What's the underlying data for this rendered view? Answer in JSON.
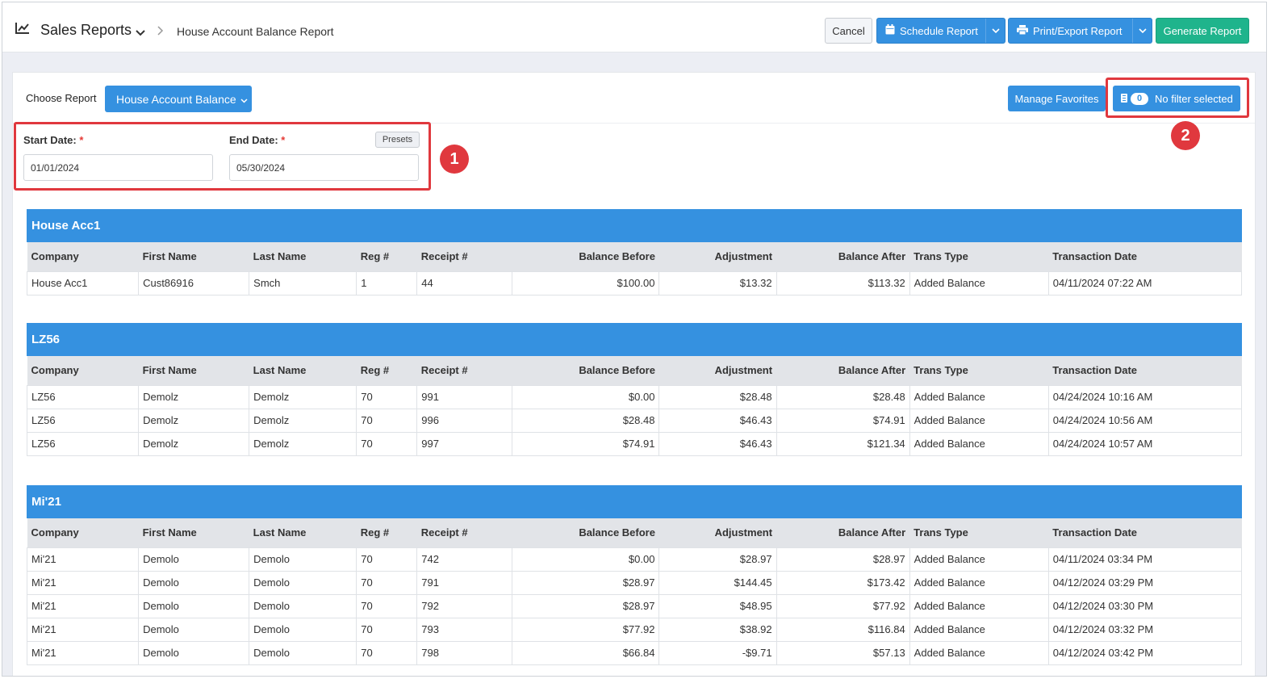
{
  "header": {
    "app_title": "Sales Reports",
    "breadcrumb": "House Account Balance Report",
    "buttons": {
      "cancel": "Cancel",
      "schedule": "Schedule Report",
      "print_export": "Print/Export Report",
      "generate": "Generate Report"
    }
  },
  "controls": {
    "choose_label": "Choose Report",
    "report_selected": "House Account Balance",
    "manage_favorites": "Manage Favorites",
    "filter_count": "0",
    "filter_label": "No filter selected",
    "start_date_label": "Start Date:",
    "end_date_label": "End Date:",
    "required_mark": "*",
    "start_date_value": "01/01/2024",
    "end_date_value": "05/30/2024",
    "presets": "Presets"
  },
  "annotations": {
    "marker1": "1",
    "marker2": "2",
    "color": "#e0383e"
  },
  "colors": {
    "primary": "#3591e0",
    "success": "#1fb48c"
  },
  "columns": [
    "Company",
    "First Name",
    "Last Name",
    "Reg #",
    "Receipt #",
    "Balance Before",
    "Adjustment",
    "Balance After",
    "Trans Type",
    "Transaction Date"
  ],
  "groups": [
    {
      "title": "House Acc1",
      "rows": [
        [
          "House Acc1",
          "Cust86916",
          "Smch",
          "1",
          "44",
          "$100.00",
          "$13.32",
          "$113.32",
          "Added Balance",
          "04/11/2024 07:22 AM"
        ]
      ]
    },
    {
      "title": "LZ56",
      "rows": [
        [
          "LZ56",
          "Demolz",
          "Demolz",
          "70",
          "991",
          "$0.00",
          "$28.48",
          "$28.48",
          "Added Balance",
          "04/24/2024 10:16 AM"
        ],
        [
          "LZ56",
          "Demolz",
          "Demolz",
          "70",
          "996",
          "$28.48",
          "$46.43",
          "$74.91",
          "Added Balance",
          "04/24/2024 10:56 AM"
        ],
        [
          "LZ56",
          "Demolz",
          "Demolz",
          "70",
          "997",
          "$74.91",
          "$46.43",
          "$121.34",
          "Added Balance",
          "04/24/2024 10:57 AM"
        ]
      ]
    },
    {
      "title": "Mi'21",
      "rows": [
        [
          "Mi'21",
          "Demolo",
          "Demolo",
          "70",
          "742",
          "$0.00",
          "$28.97",
          "$28.97",
          "Added Balance",
          "04/11/2024 03:34 PM"
        ],
        [
          "Mi'21",
          "Demolo",
          "Demolo",
          "70",
          "791",
          "$28.97",
          "$144.45",
          "$173.42",
          "Added Balance",
          "04/12/2024 03:29 PM"
        ],
        [
          "Mi'21",
          "Demolo",
          "Demolo",
          "70",
          "792",
          "$28.97",
          "$48.95",
          "$77.92",
          "Added Balance",
          "04/12/2024 03:30 PM"
        ],
        [
          "Mi'21",
          "Demolo",
          "Demolo",
          "70",
          "793",
          "$77.92",
          "$38.92",
          "$116.84",
          "Added Balance",
          "04/12/2024 03:32 PM"
        ],
        [
          "Mi'21",
          "Demolo",
          "Demolo",
          "70",
          "798",
          "$66.84",
          "-$9.71",
          "$57.13",
          "Added Balance",
          "04/12/2024 03:42 PM"
        ]
      ]
    }
  ]
}
